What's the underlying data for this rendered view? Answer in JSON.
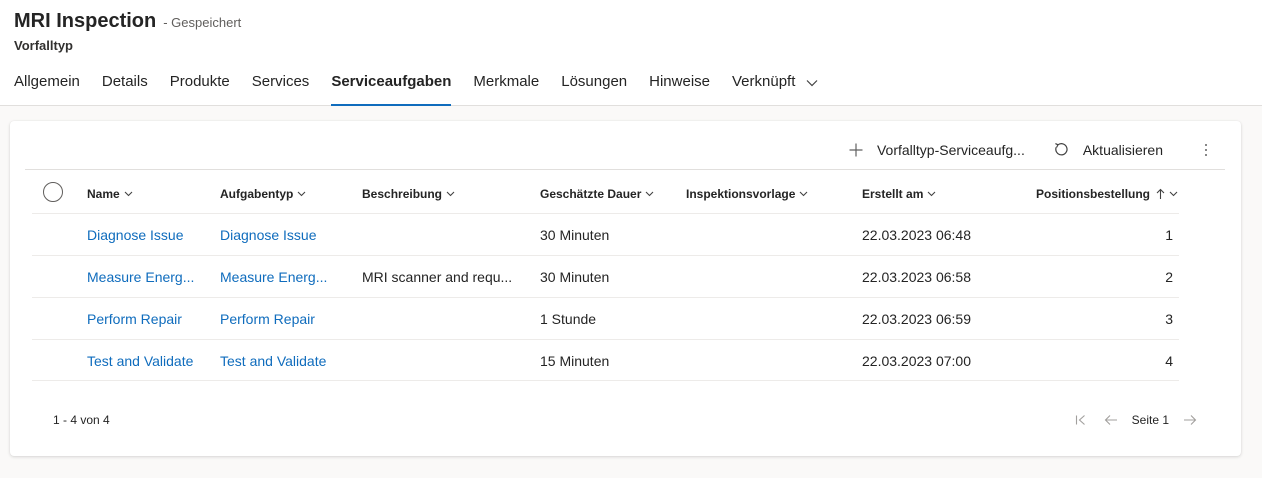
{
  "header": {
    "title": "MRI Inspection",
    "saved_status": "- Gespeichert",
    "entity_type": "Vorfalltyp"
  },
  "tabs": [
    {
      "label": "Allgemein",
      "active": false
    },
    {
      "label": "Details",
      "active": false
    },
    {
      "label": "Produkte",
      "active": false
    },
    {
      "label": "Services",
      "active": false
    },
    {
      "label": "Serviceaufgaben",
      "active": true
    },
    {
      "label": "Merkmale",
      "active": false
    },
    {
      "label": "Lösungen",
      "active": false
    },
    {
      "label": "Hinweise",
      "active": false
    },
    {
      "label": "Verknüpft",
      "active": false
    }
  ],
  "commands": {
    "new_label": "Vorfalltyp-Serviceaufg...",
    "refresh_label": "Aktualisieren"
  },
  "grid": {
    "columns": {
      "name": "Name",
      "task_type": "Aufgabentyp",
      "description": "Beschreibung",
      "duration": "Geschätzte Dauer",
      "inspection_template": "Inspektionsvorlage",
      "created_on": "Erstellt am",
      "line_order": "Positionsbestellung"
    },
    "rows": [
      {
        "name": "Diagnose Issue",
        "task_type": "Diagnose Issue",
        "description": "",
        "duration": "30 Minuten",
        "inspection_template": "",
        "created_on": "22.03.2023 06:48",
        "line_order": "1"
      },
      {
        "name": "Measure Energ...",
        "task_type": "Measure Energ...",
        "description": "MRI scanner and requ...",
        "duration": "30 Minuten",
        "inspection_template": "",
        "created_on": "22.03.2023 06:58",
        "line_order": "2"
      },
      {
        "name": "Perform Repair",
        "task_type": "Perform Repair",
        "description": "",
        "duration": "1 Stunde",
        "inspection_template": "",
        "created_on": "22.03.2023 06:59",
        "line_order": "3"
      },
      {
        "name": "Test and Validate",
        "task_type": "Test and Validate",
        "description": "",
        "duration": "15 Minuten",
        "inspection_template": "",
        "created_on": "22.03.2023 07:00",
        "line_order": "4"
      }
    ],
    "record_count": "1 - 4 von 4",
    "page_label": "Seite 1"
  },
  "colors": {
    "accent": "#0f6cbd",
    "text": "#242424",
    "divider": "#edebe9"
  },
  "icons": [
    "chevron-down-icon",
    "add-icon",
    "refresh-icon",
    "more-vertical-icon",
    "sort-ascending-icon",
    "first-page-icon",
    "previous-page-icon",
    "next-page-icon"
  ]
}
